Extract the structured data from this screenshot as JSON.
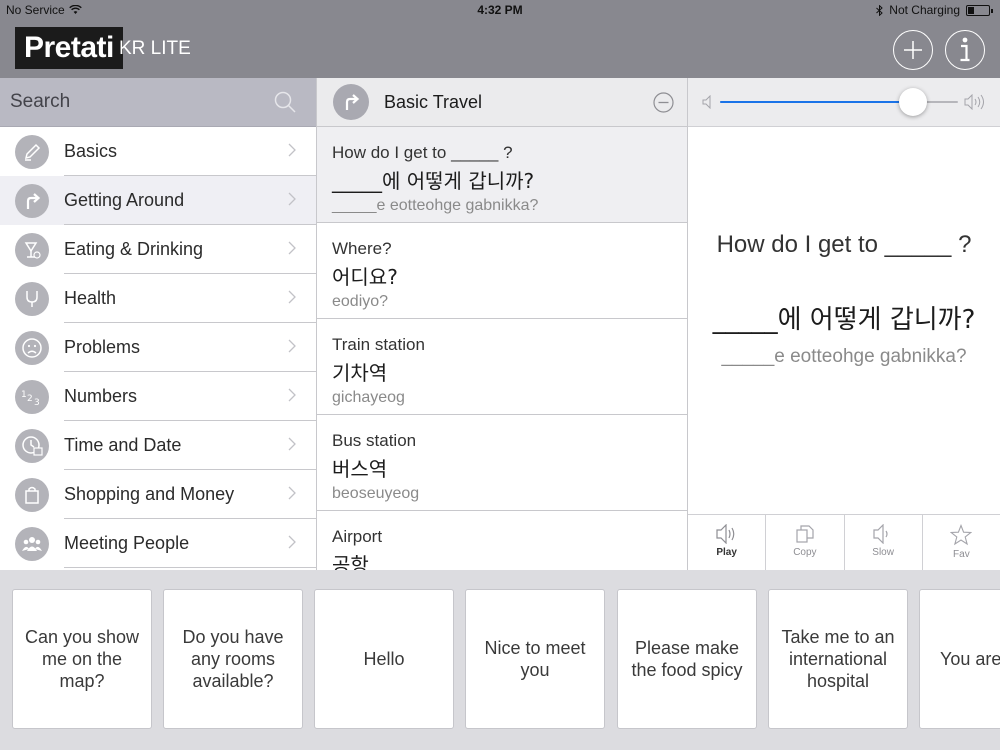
{
  "status_bar": {
    "carrier": "No Service",
    "time": "4:32 PM",
    "charging": "Not Charging",
    "battery_level": 0.35
  },
  "header": {
    "logo": "Pretati",
    "subtitle": "KR LITE",
    "add_icon": "plus-icon",
    "info_icon": "info-icon"
  },
  "sidebar": {
    "search_placeholder": "Search",
    "categories": [
      {
        "label": "Basics",
        "icon": "pencil-icon"
      },
      {
        "label": "Getting Around",
        "icon": "turn-arrow-icon",
        "selected": true
      },
      {
        "label": "Eating & Drinking",
        "icon": "cocktail-icon"
      },
      {
        "label": "Health",
        "icon": "stethoscope-icon"
      },
      {
        "label": "Problems",
        "icon": "sad-face-icon"
      },
      {
        "label": "Numbers",
        "icon": "numbers-icon"
      },
      {
        "label": "Time and Date",
        "icon": "clock-calendar-icon"
      },
      {
        "label": "Shopping and Money",
        "icon": "shopping-bag-icon"
      },
      {
        "label": "Meeting People",
        "icon": "people-icon"
      }
    ]
  },
  "phrase_list": {
    "title": "Basic Travel",
    "phrases": [
      {
        "en": "How do I get to _____ ?",
        "kr": "_____에 어떻게 갑니까?",
        "rom": "_____e eotteohge gabnikka?"
      },
      {
        "en": "Where?",
        "kr": "어디요?",
        "rom": "eodiyo?"
      },
      {
        "en": "Train station",
        "kr": "기차역",
        "rom": "gichayeog"
      },
      {
        "en": "Bus station",
        "kr": "버스역",
        "rom": "beoseuyeog"
      },
      {
        "en": "Airport",
        "kr": "공항",
        "rom": ""
      }
    ]
  },
  "detail": {
    "volume": 0.81,
    "en": "How do I get to _____ ?",
    "kr": "_____에 어떻게 갑니까?",
    "rom": "_____e eotteohge gabnikka?",
    "actions": [
      {
        "label": "Play",
        "icon": "speaker-icon"
      },
      {
        "label": "Copy",
        "icon": "copy-icon"
      },
      {
        "label": "Slow",
        "icon": "speaker-slow-icon"
      },
      {
        "label": "Fav",
        "icon": "star-icon"
      }
    ]
  },
  "quick_cards": [
    "Can you show me on the map?",
    "Do you have any rooms available?",
    "Hello",
    "Nice to meet you",
    "Please make the food spicy",
    "Take me to an international hospital",
    "You are beaut"
  ],
  "colors": {
    "header_bg": "#88888f",
    "accent": "#1a73e8",
    "icon_bg": "#b3b3b9"
  }
}
